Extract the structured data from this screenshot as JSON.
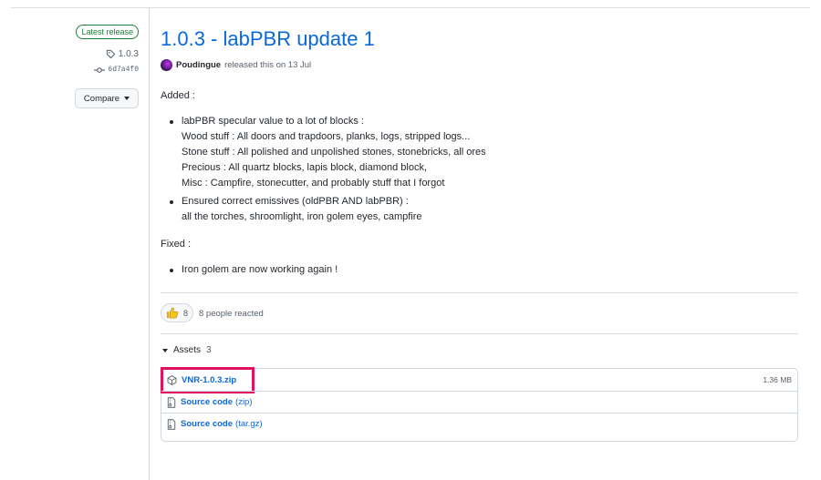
{
  "sidebar": {
    "latest_badge": "Latest release",
    "tag": "1.0.3",
    "commit": "6d7a4f0",
    "compare_label": "Compare"
  },
  "release": {
    "title": "1.0.3 - labPBR update 1",
    "author": "Poudingue",
    "released_text": "released this on 13 Jul",
    "added_heading": "Added :",
    "added_items": [
      {
        "lines": [
          "labPBR specular value to a lot of blocks :",
          "Wood stuff : All doors and trapdoors, planks, logs, stripped logs...",
          "Stone stuff : All polished and unpolished stones, stonebricks, all ores",
          "Precious : All quartz blocks, lapis block, diamond block,",
          "Misc : Campfire, stonecutter, and probably stuff that I forgot"
        ]
      },
      {
        "lines": [
          "Ensured correct emissives (oldPBR AND labPBR) :",
          "all the torches, shroomlight, iron golem eyes, campfire"
        ]
      }
    ],
    "fixed_heading": "Fixed :",
    "fixed_items": [
      "Iron golem are now working again !"
    ]
  },
  "reactions": {
    "count": "8",
    "text": "8 people reacted"
  },
  "assets": {
    "label": "Assets",
    "count": "3",
    "items": [
      {
        "name": "VNR-1.0.3.zip",
        "ext": "",
        "size": "1.36 MB",
        "icon": "package-icon",
        "highlighted": true
      },
      {
        "name": "Source code",
        "ext": "(zip)",
        "size": "",
        "icon": "file-zip-icon"
      },
      {
        "name": "Source code",
        "ext": "(tar.gz)",
        "size": "",
        "icon": "file-zip-icon"
      }
    ]
  },
  "colors": {
    "link": "#0969da",
    "success": "#1a7f37",
    "highlight_box": "#e3115d"
  }
}
